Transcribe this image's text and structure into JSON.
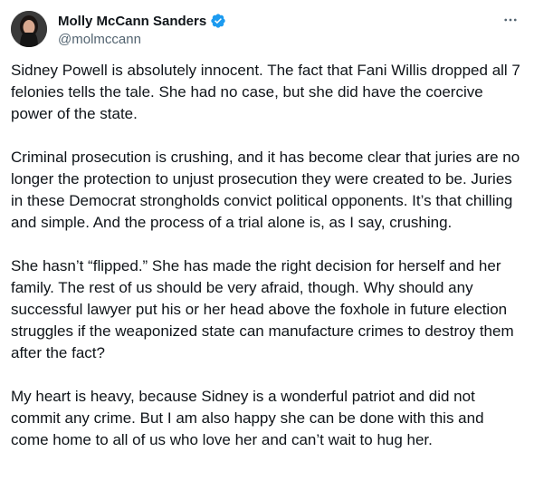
{
  "author": {
    "display_name": "Molly McCann Sanders",
    "handle": "@molmccann",
    "verified": true,
    "avatar_icon": "profile-photo"
  },
  "icons": {
    "verified_color": "#1d9bf0",
    "more_icon": "more-horizontal-icon"
  },
  "tweet": {
    "paragraphs": [
      "Sidney Powell is absolutely innocent. The fact that Fani Willis dropped all 7 felonies tells the tale. She had no case, but she did have the coercive power of the state.",
      "Criminal prosecution is crushing, and it has become clear that juries are no longer the protection to unjust prosecution they were created to be. Juries in these Democrat strongholds convict political opponents. It’s that chilling and simple. And the process of a trial alone is, as I say, crushing.",
      "She hasn’t “flipped.” She has made the right decision for herself and her family. The rest of us should be very afraid, though. Why should any successful lawyer put his or her head above the foxhole in future election struggles if the weaponized state can manufacture crimes to destroy them after the fact?",
      "My heart is heavy, because Sidney is a wonderful patriot and did not commit any crime. But I am also happy she can be done with this and come home to all of us who love her and can’t wait to hug her."
    ]
  }
}
